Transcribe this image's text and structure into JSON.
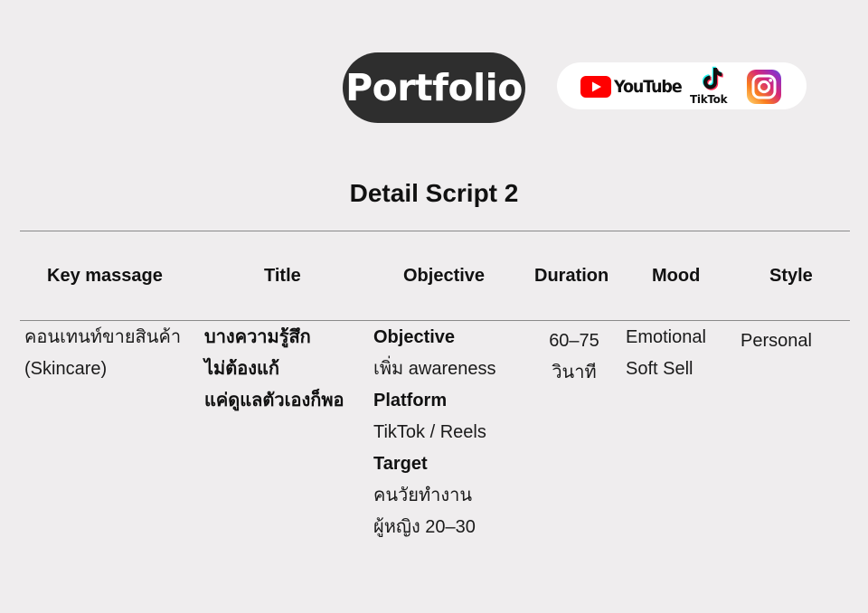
{
  "header": {
    "portfolio_label": "Portfolio",
    "social": {
      "youtube_label": "YouTube",
      "tiktok_label": "TikTok",
      "instagram_icon": "instagram-icon",
      "colors": {
        "youtube_red": "#ff0000",
        "tiktok_cyan": "#25f4ee",
        "tiktok_pink": "#fe2c55"
      }
    }
  },
  "title": "Detail Script 2",
  "table": {
    "headers": [
      "Key massage",
      "Title",
      "Objective",
      "Duration",
      "Mood",
      "Style"
    ],
    "row": {
      "key_message": [
        "คอนเทนท์ขายสินค้า",
        "(Skincare)"
      ],
      "title": [
        "บางความรู้สึก",
        "ไม่ต้องแก้",
        "แค่ดูแลตัวเองก็พอ"
      ],
      "objective": {
        "objective_label": "Objective",
        "objective_value": "เพิ่ม awareness",
        "platform_label": "Platform",
        "platform_value": "TikTok / Reels",
        "target_label": "Target",
        "target_value_1": "คนวัยทำงาน",
        "target_value_2": "ผู้หญิง 20–30"
      },
      "duration": [
        "60–75",
        "วินาที"
      ],
      "mood": [
        "Emotional",
        "Soft Sell"
      ],
      "style": "Personal"
    }
  }
}
